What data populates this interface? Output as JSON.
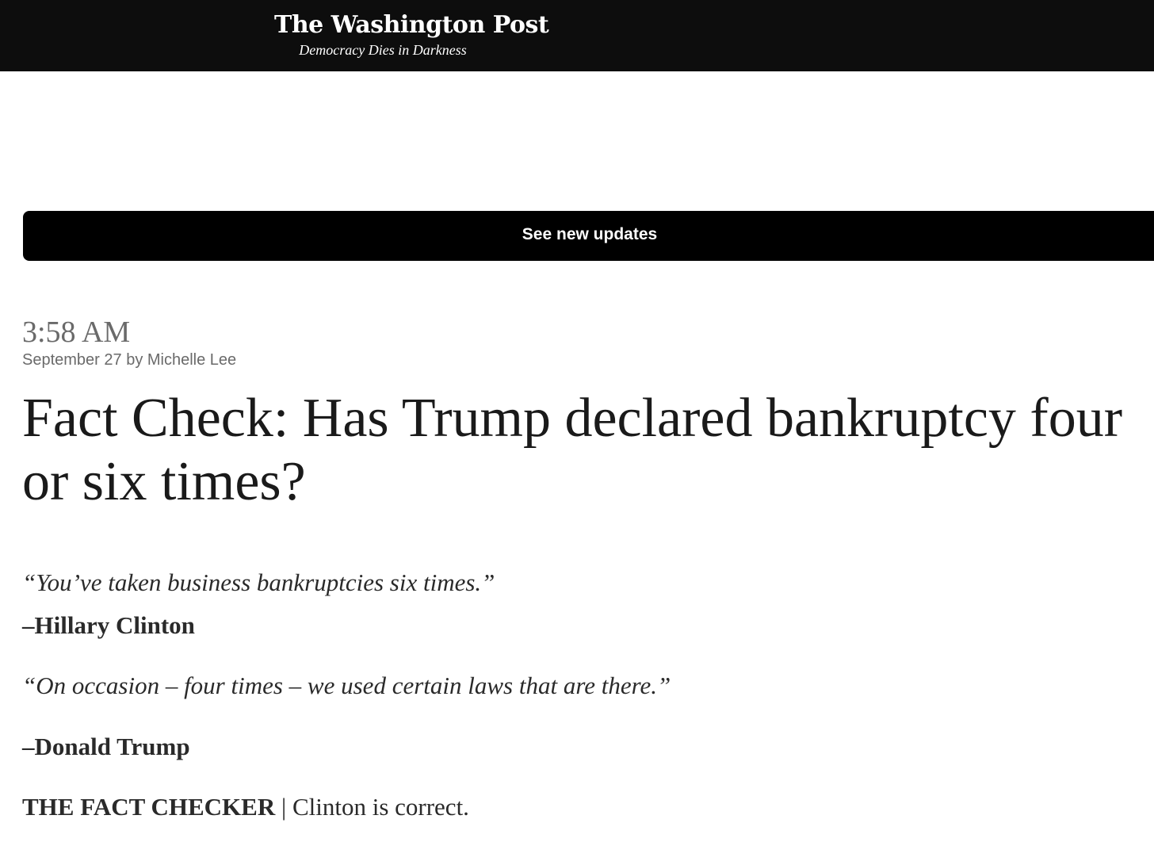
{
  "header": {
    "brand_name": "The Washington Post",
    "tagline": "Democracy Dies in Darkness"
  },
  "updates_button": {
    "label": "See new updates"
  },
  "post": {
    "time": "3:58 AM",
    "meta": "September 27 by Michelle Lee",
    "headline": "Fact Check: Has Trump declared bankruptcy four or six times?",
    "quotes": [
      {
        "text": "“You’ve taken business bankruptcies six times.”",
        "attribution": "–Hillary Clinton"
      },
      {
        "text": "“On occasion – four times – we used certain laws that are there.”",
        "attribution": "–Donald Trump"
      }
    ],
    "verdict": {
      "label": "THE FACT CHECKER",
      "separator": " | ",
      "text": "Clinton is correct."
    }
  }
}
